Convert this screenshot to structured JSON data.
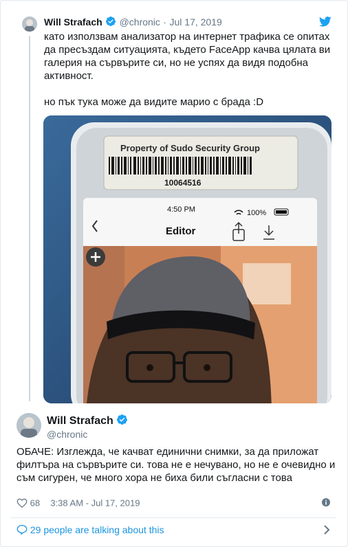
{
  "tweet1": {
    "author_name": "Will Strafach",
    "handle": "@chronic",
    "separator": "·",
    "date": "Jul 17, 2019",
    "text_lines": [
      "като използвам анализатор на интернет трафика се опитах да пресъздам ситуацията, където FaceApp качва цялата ви галерия на сървърите си, но не успях да видя подобна активност.",
      "но пък тука може да видите марио с брада :D"
    ]
  },
  "media": {
    "sticker_text": "Property of Sudo Security Group",
    "barcode_number": "10064516",
    "status_time": "4:50 PM",
    "battery": "100%",
    "editor_title": "Editor"
  },
  "tweet2": {
    "author_name": "Will Strafach",
    "handle": "@chronic",
    "text": "ОБАЧЕ: Изглежда, че качват единични снимки, за да приложат филтъра на сървърите си. това не е нечувано, но не е очевидно и съм сигурен, че много хора не биха били съгласни с това",
    "likes": "68",
    "timestamp": "3:38 AM - Jul 17, 2019"
  },
  "footer": {
    "talking_text": "29 people are talking about this"
  },
  "colors": {
    "twitter_blue": "#1da1f2",
    "link_blue": "#1b95e0",
    "muted": "#657786",
    "border": "#e1e8ed"
  },
  "icons": [
    "twitter-bird-icon",
    "verified-badge-icon",
    "heart-icon",
    "info-icon",
    "speech-bubble-icon",
    "chevron-right-icon"
  ]
}
